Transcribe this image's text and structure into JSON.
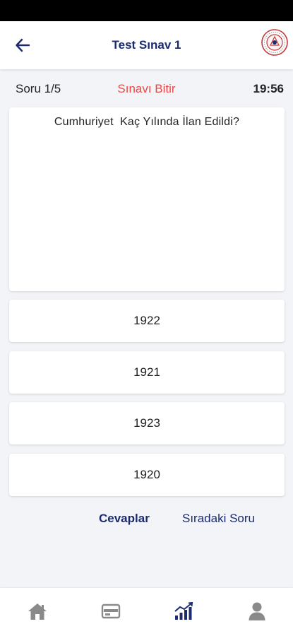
{
  "app_bar": {
    "title": "Test Sınav 1",
    "back_icon": "arrow-left-icon",
    "logo_icon": "institution-seal-logo"
  },
  "info": {
    "question_counter": "Soru 1/5",
    "finish_label": "Sınavı Bitir",
    "timer": "19:56"
  },
  "question": {
    "text": "Cumhuriyet  Kaç Yılında İlan Edildi?"
  },
  "options": [
    {
      "label": "1922"
    },
    {
      "label": "1921"
    },
    {
      "label": "1923"
    },
    {
      "label": "1920"
    }
  ],
  "actions": {
    "answers_label": "Cevaplar",
    "next_label": "Sıradaki Soru"
  },
  "bottom_nav": {
    "items": [
      {
        "icon": "home-icon"
      },
      {
        "icon": "card-icon"
      },
      {
        "icon": "chart-icon",
        "active": true
      },
      {
        "icon": "user-icon"
      }
    ]
  },
  "colors": {
    "primary": "#1c2b6e",
    "finish": "#e84a4a",
    "nav_inactive": "#8a8a8a",
    "background": "#f3f4f7"
  }
}
